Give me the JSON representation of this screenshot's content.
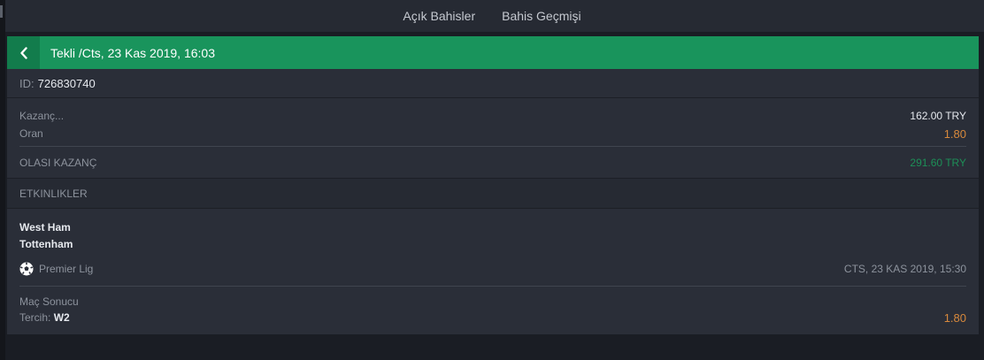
{
  "tabs": {
    "open_bets": "Açık Bahisler",
    "bet_history": "Bahis Geçmişi"
  },
  "header": {
    "title": "Tekli /Cts, 23 Kas 2019, 16:03",
    "back_icon": "chevron-left-icon"
  },
  "bet_id": {
    "label": "ID:",
    "value": "726830740"
  },
  "stake": {
    "stake_label": "Kazanç...",
    "stake_value": "162.00 TRY",
    "odds_label": "Oran",
    "odds_value": "1.80",
    "potential_label": "OLASI KAZANÇ",
    "potential_value": "291.60 TRY"
  },
  "events_section": {
    "title": "ETKINLIKLER"
  },
  "event": {
    "home": "West Ham",
    "away": "Tottenham",
    "league": "Premier Lig",
    "sport_icon": "soccer-ball-icon",
    "datetime": "CTS, 23 KAS 2019, 15:30",
    "market_label": "Maç Sonucu",
    "selection_label": "Tercih:",
    "selection_value": "W2",
    "odds": "1.80"
  },
  "colors": {
    "header_green": "#19945c",
    "odds_orange": "#d8893c",
    "win_green": "#1d8f57"
  }
}
